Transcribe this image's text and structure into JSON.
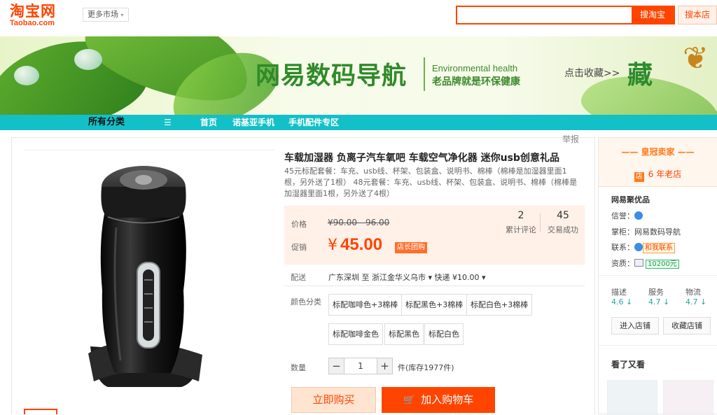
{
  "header": {
    "logo_cn": "淘宝网",
    "logo_en": "Taobao.com",
    "market_label": "更多市场",
    "search_button": "搜淘宝",
    "search_store_button": "搜本店"
  },
  "banner": {
    "title": "网易数码导航",
    "subtitle_en": "Environmental health",
    "slogan": "老品牌就是环保健康",
    "favorite": "点击收藏>>",
    "favorite_char": "藏"
  },
  "nav": {
    "all_categories": "所有分类",
    "items": [
      "首页",
      "诺基亚手机",
      "手机配件专区"
    ]
  },
  "product": {
    "report": "举报",
    "title": "车载加湿器 负离子汽车氧吧 车载空气净化器 迷你usb创意礼品",
    "description": "45元标配套餐：车充、usb线、杯架、包装盒、说明书、棉棒（棉棒是加湿器里面1根，另外送了1根） 48元套餐：车充、usb线、杯架、包装盒、说明书、棉棒（棉棒是加湿器里面1根，另外送了4根）",
    "price_label": "价格",
    "original_price": "¥90.00 - 96.00",
    "promo_label": "促销",
    "promo_currency": "¥",
    "promo_price": "45.00",
    "promo_tag": "店长团购",
    "stats": [
      {
        "value": "2",
        "label": "累计评论"
      },
      {
        "value": "45",
        "label": "交易成功"
      }
    ],
    "shipping_label": "配送",
    "shipping_text": "广东深圳 至  浙江金华义乌市 ▾   快递 ¥10.00 ▾",
    "color_label": "颜色分类",
    "colors": [
      "标配咖啡色+3棉棒",
      "标配黑色+3棉棒",
      "标配白色+3棉棒",
      "标配咖啡金色",
      "标配黑色",
      "标配白色"
    ],
    "qty_label": "数量",
    "qty_value": "1",
    "qty_minus": "−",
    "qty_plus": "+",
    "stock": "件(库存1977件)",
    "buy_now": "立即购买",
    "add_to_cart": "加入购物车"
  },
  "seller": {
    "crown": "—— 皇冠卖家 ——",
    "years_icon": "店",
    "years": "6 年老店",
    "shop_name": "网易聚优品",
    "reputation_label": "信誉：",
    "keeper_label": "掌柜：",
    "keeper_name": "网易数码导航",
    "contact_label": "联系：",
    "contact_badge": "和我联系",
    "qualification_label": "资质：",
    "deposit": "10200元",
    "scores": [
      {
        "label": "描述",
        "value": "4.6 ↓"
      },
      {
        "label": "服务",
        "value": "4.7 ↓"
      },
      {
        "label": "物流",
        "value": "4.7 ↓"
      }
    ],
    "enter_store": "进入店铺",
    "favorite_store": "收藏店铺",
    "see_also": "看了又看"
  },
  "colors": {
    "accent": "#ff4400",
    "nav_bg": "#13c0c7",
    "price_bg": "#fff0e8"
  }
}
